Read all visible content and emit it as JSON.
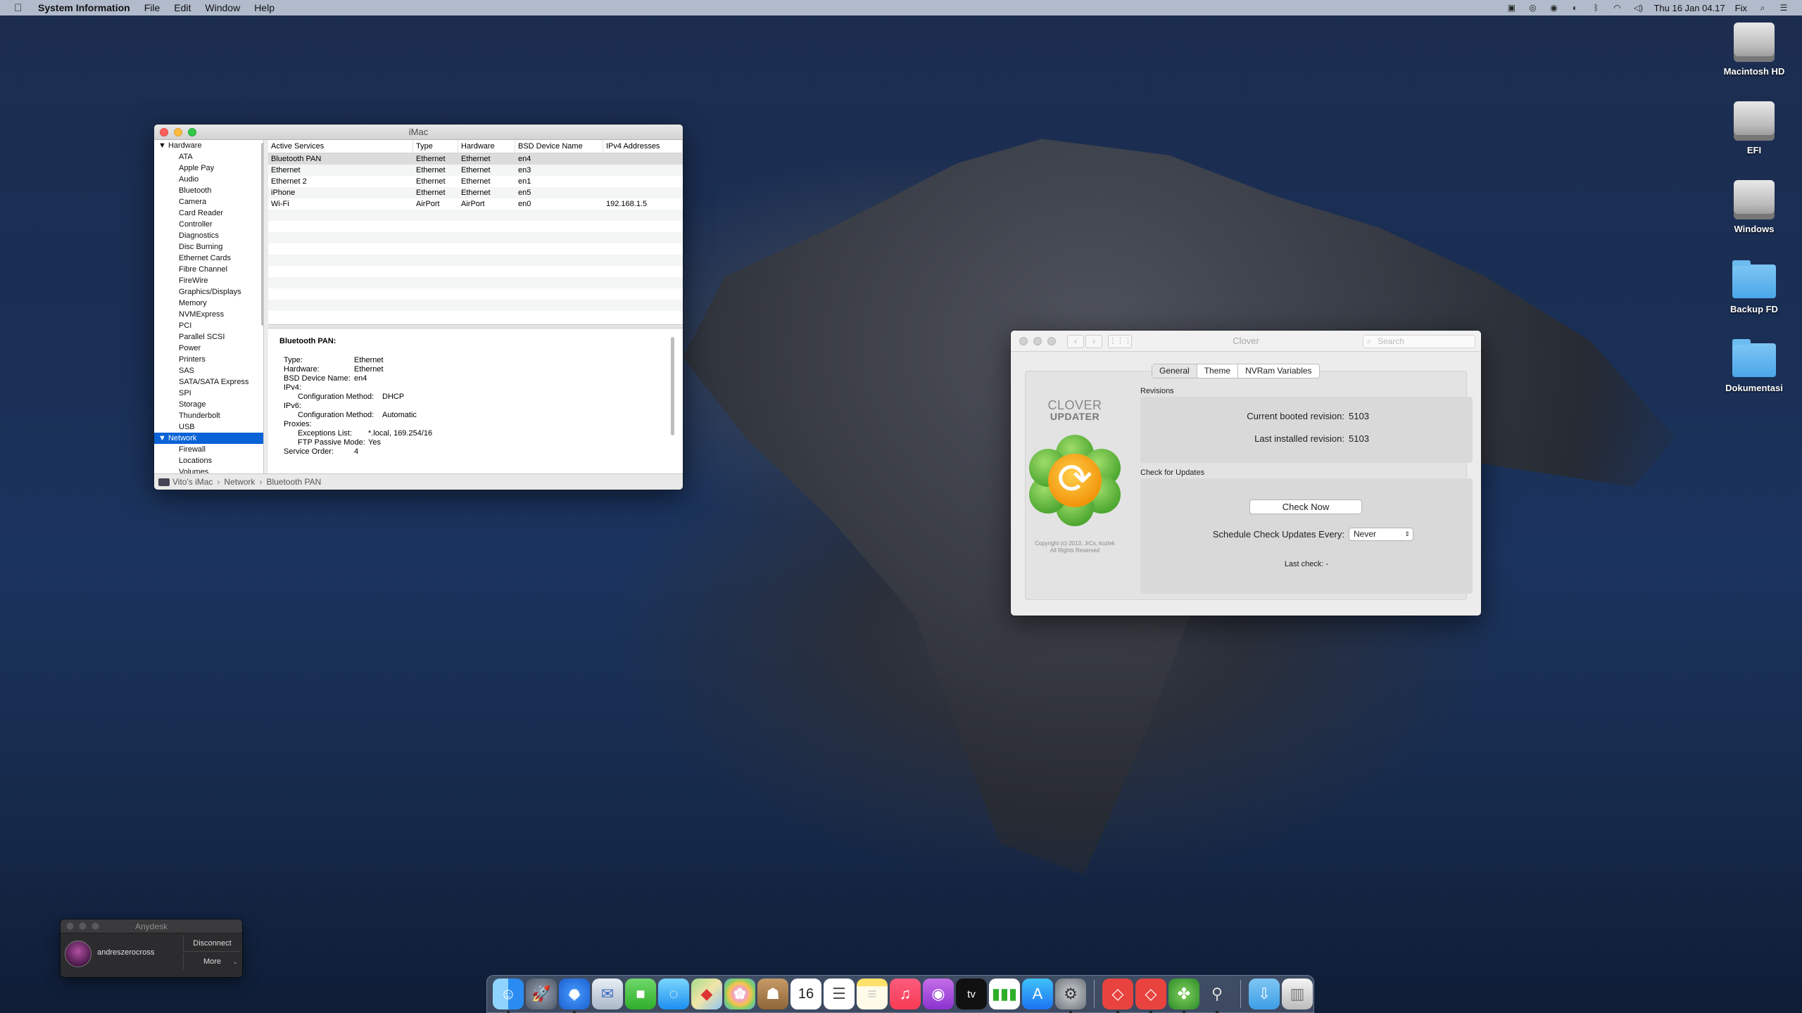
{
  "menubar": {
    "app_name": "System Information",
    "menus": [
      "File",
      "Edit",
      "Window",
      "Help"
    ],
    "clock": "Thu 16 Jan  04.17",
    "user": "Fix"
  },
  "desktop_icons": [
    {
      "label": "Macintosh HD",
      "kind": "drive"
    },
    {
      "label": "EFI",
      "kind": "drive"
    },
    {
      "label": "Windows",
      "kind": "drive"
    },
    {
      "label": "Backup FD",
      "kind": "folder"
    },
    {
      "label": "Dokumentasi",
      "kind": "folder"
    }
  ],
  "sysinfo": {
    "title": "iMac",
    "sidebar": {
      "hardware_label": "Hardware",
      "hardware_items": [
        "ATA",
        "Apple Pay",
        "Audio",
        "Bluetooth",
        "Camera",
        "Card Reader",
        "Controller",
        "Diagnostics",
        "Disc Burning",
        "Ethernet Cards",
        "Fibre Channel",
        "FireWire",
        "Graphics/Displays",
        "Memory",
        "NVMExpress",
        "PCI",
        "Parallel SCSI",
        "Power",
        "Printers",
        "SAS",
        "SATA/SATA Express",
        "SPI",
        "Storage",
        "Thunderbolt",
        "USB"
      ],
      "network_label": "Network",
      "network_items": [
        "Firewall",
        "Locations",
        "Volumes"
      ]
    },
    "table": {
      "headers": [
        "Active Services",
        "Type",
        "Hardware",
        "BSD Device Name",
        "IPv4 Addresses"
      ],
      "rows": [
        [
          "Bluetooth PAN",
          "Ethernet",
          "Ethernet",
          "en4",
          ""
        ],
        [
          "Ethernet",
          "Ethernet",
          "Ethernet",
          "en3",
          ""
        ],
        [
          "Ethernet 2",
          "Ethernet",
          "Ethernet",
          "en1",
          ""
        ],
        [
          "iPhone",
          "Ethernet",
          "Ethernet",
          "en5",
          ""
        ],
        [
          "Wi-Fi",
          "AirPort",
          "AirPort",
          "en0",
          "192.168.1.5"
        ]
      ]
    },
    "detail": {
      "heading": "Bluetooth PAN:",
      "type_k": "Type:",
      "type_v": "Ethernet",
      "hw_k": "Hardware:",
      "hw_v": "Ethernet",
      "bsd_k": "BSD Device Name:",
      "bsd_v": "en4",
      "ipv4_k": "IPv4:",
      "cfg4_k": "Configuration Method:",
      "cfg4_v": "DHCP",
      "ipv6_k": "IPv6:",
      "cfg6_k": "Configuration Method:",
      "cfg6_v": "Automatic",
      "proxies_k": "Proxies:",
      "exc_k": "Exceptions List:",
      "exc_v": "*.local, 169.254/16",
      "ftp_k": "FTP Passive Mode:",
      "ftp_v": "Yes",
      "order_k": "Service Order:",
      "order_v": "4"
    },
    "breadcrumb": [
      "Vito's iMac",
      "Network",
      "Bluetooth PAN"
    ]
  },
  "clover": {
    "title": "Clover",
    "search_placeholder": "Search",
    "tabs": [
      "General",
      "Theme",
      "NVRam Variables"
    ],
    "logo_title": "CLOVER",
    "logo_sub": "UPDATER",
    "copyright_1": "Copyright (c) 2013, JrCs, kozlek",
    "copyright_2": "All Rights Reserved",
    "revisions_label": "Revisions",
    "current_label": "Current booted revision:",
    "current_value": "5103",
    "installed_label": "Last installed revision:",
    "installed_value": "5103",
    "check_label": "Check for Updates",
    "check_button": "Check Now",
    "schedule_label": "Schedule Check Updates Every:",
    "schedule_value": "Never",
    "last_check": "Last check: -"
  },
  "anydesk": {
    "title": "Anydesk",
    "user": "andreszerocross",
    "disconnect": "Disconnect",
    "more": "More"
  },
  "dock": {
    "apps": [
      "finder-icon",
      "launchpad-icon",
      "safari-icon",
      "mail-icon",
      "facetime-icon",
      "messages-icon",
      "maps-icon",
      "photos-icon",
      "contacts-icon",
      "calendar-icon",
      "reminders-icon",
      "notes-icon",
      "music-icon",
      "podcasts-icon",
      "tv-icon",
      "numbers-icon",
      "app-store-icon",
      "system-preferences-icon",
      "anydesk-icon",
      "anydesk-2-icon",
      "clover-icon",
      "utility-icon",
      "downloads-folder-icon",
      "trash-icon"
    ],
    "calendar_day": "16",
    "tv_label": "tv"
  }
}
